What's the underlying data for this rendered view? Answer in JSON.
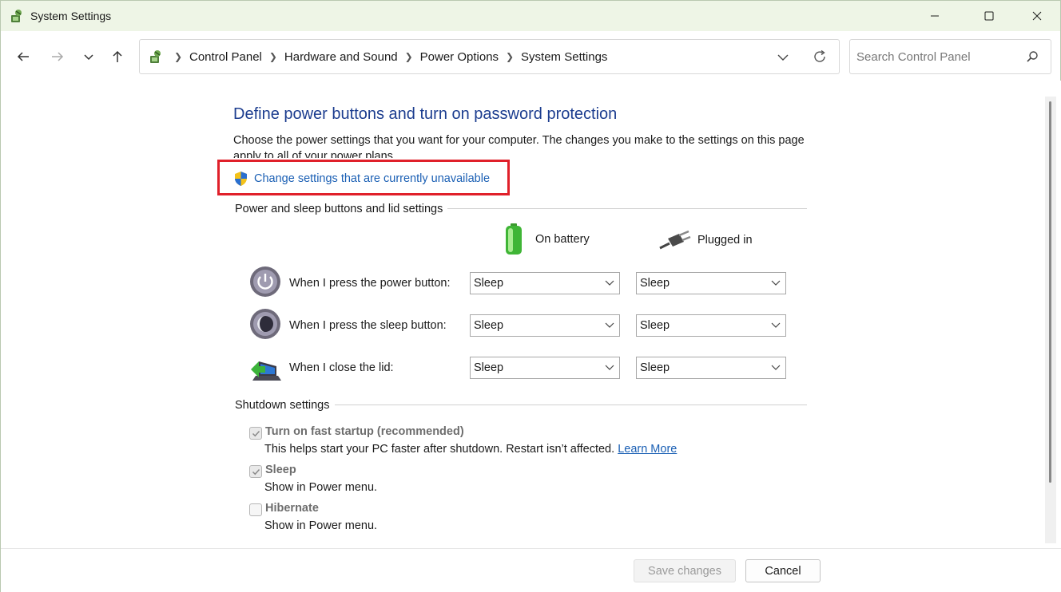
{
  "window": {
    "title": "System Settings"
  },
  "breadcrumb": {
    "items": [
      "Control Panel",
      "Hardware and Sound",
      "Power Options",
      "System Settings"
    ]
  },
  "search": {
    "placeholder": "Search Control Panel"
  },
  "page": {
    "heading": "Define power buttons and turn on password protection",
    "description": "Choose the power settings that you want for your computer. The changes you make to the settings on this page apply to all of your power plans.",
    "change_link": "Change settings that are currently unavailable"
  },
  "power_section": {
    "title": "Power and sleep buttons and lid settings",
    "columns": {
      "battery": "On battery",
      "plugged": "Plugged in"
    },
    "rows": [
      {
        "label": "When I press the power button:",
        "battery": "Sleep",
        "plugged": "Sleep"
      },
      {
        "label": "When I press the sleep button:",
        "battery": "Sleep",
        "plugged": "Sleep"
      },
      {
        "label": "When I close the lid:",
        "battery": "Sleep",
        "plugged": "Sleep"
      }
    ]
  },
  "shutdown_section": {
    "title": "Shutdown settings",
    "options": [
      {
        "title": "Turn on fast startup (recommended)",
        "description": "This helps start your PC faster after shutdown. Restart isn’t affected.",
        "link": "Learn More",
        "checked": true
      },
      {
        "title": "Sleep",
        "description": "Show in Power menu.",
        "checked": true
      },
      {
        "title": "Hibernate",
        "description": "Show in Power menu.",
        "checked": false
      }
    ]
  },
  "footer": {
    "save_label": "Save changes",
    "cancel_label": "Cancel"
  },
  "colors": {
    "heading": "#1c3d8f",
    "link": "#1a5fb4",
    "highlight": "#e0202a",
    "titlebar": "#eef5e6"
  }
}
